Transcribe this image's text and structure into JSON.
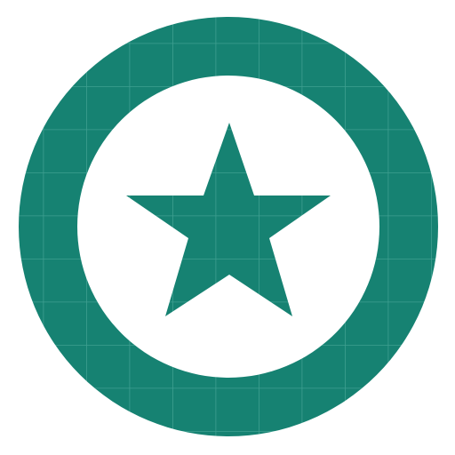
{
  "app_icon": {
    "icon_name": "star-badge-icon",
    "colors": {
      "badge_fill": "#168272",
      "grid_line": "#4aa899",
      "inner_circle": "#ffffff",
      "page_background": "#ffffff"
    }
  }
}
